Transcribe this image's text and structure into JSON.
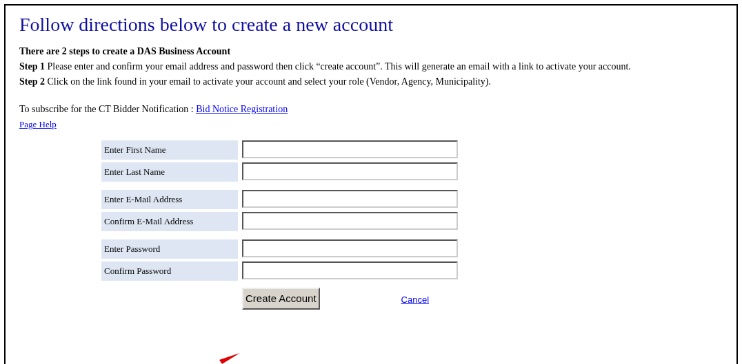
{
  "title": "Follow directions below to create a new account",
  "intro": "There are 2 steps to create a DAS Business Account",
  "steps": [
    {
      "label": "Step 1",
      "text": "Please enter and confirm your email address and password then click “create account”. This will generate an email with a link to activate your account."
    },
    {
      "label": "Step 2",
      "text": "Click on the link found in your email to activate your account and select your role (Vendor, Agency, Municipality)."
    }
  ],
  "subscribe": {
    "text": "To subscribe for the CT Bidder Notification :",
    "link": "Bid Notice Registration"
  },
  "help_link": "Page Help",
  "field_groups": [
    [
      {
        "label": "Enter First Name"
      },
      {
        "label": "Enter Last Name"
      }
    ],
    [
      {
        "label": "Enter E-Mail Address"
      },
      {
        "label": "Confirm E-Mail Address"
      }
    ],
    [
      {
        "label": "Enter Password"
      },
      {
        "label": "Confirm Password"
      }
    ]
  ],
  "submit_button": "Create Account",
  "cancel_link": "Cancel"
}
